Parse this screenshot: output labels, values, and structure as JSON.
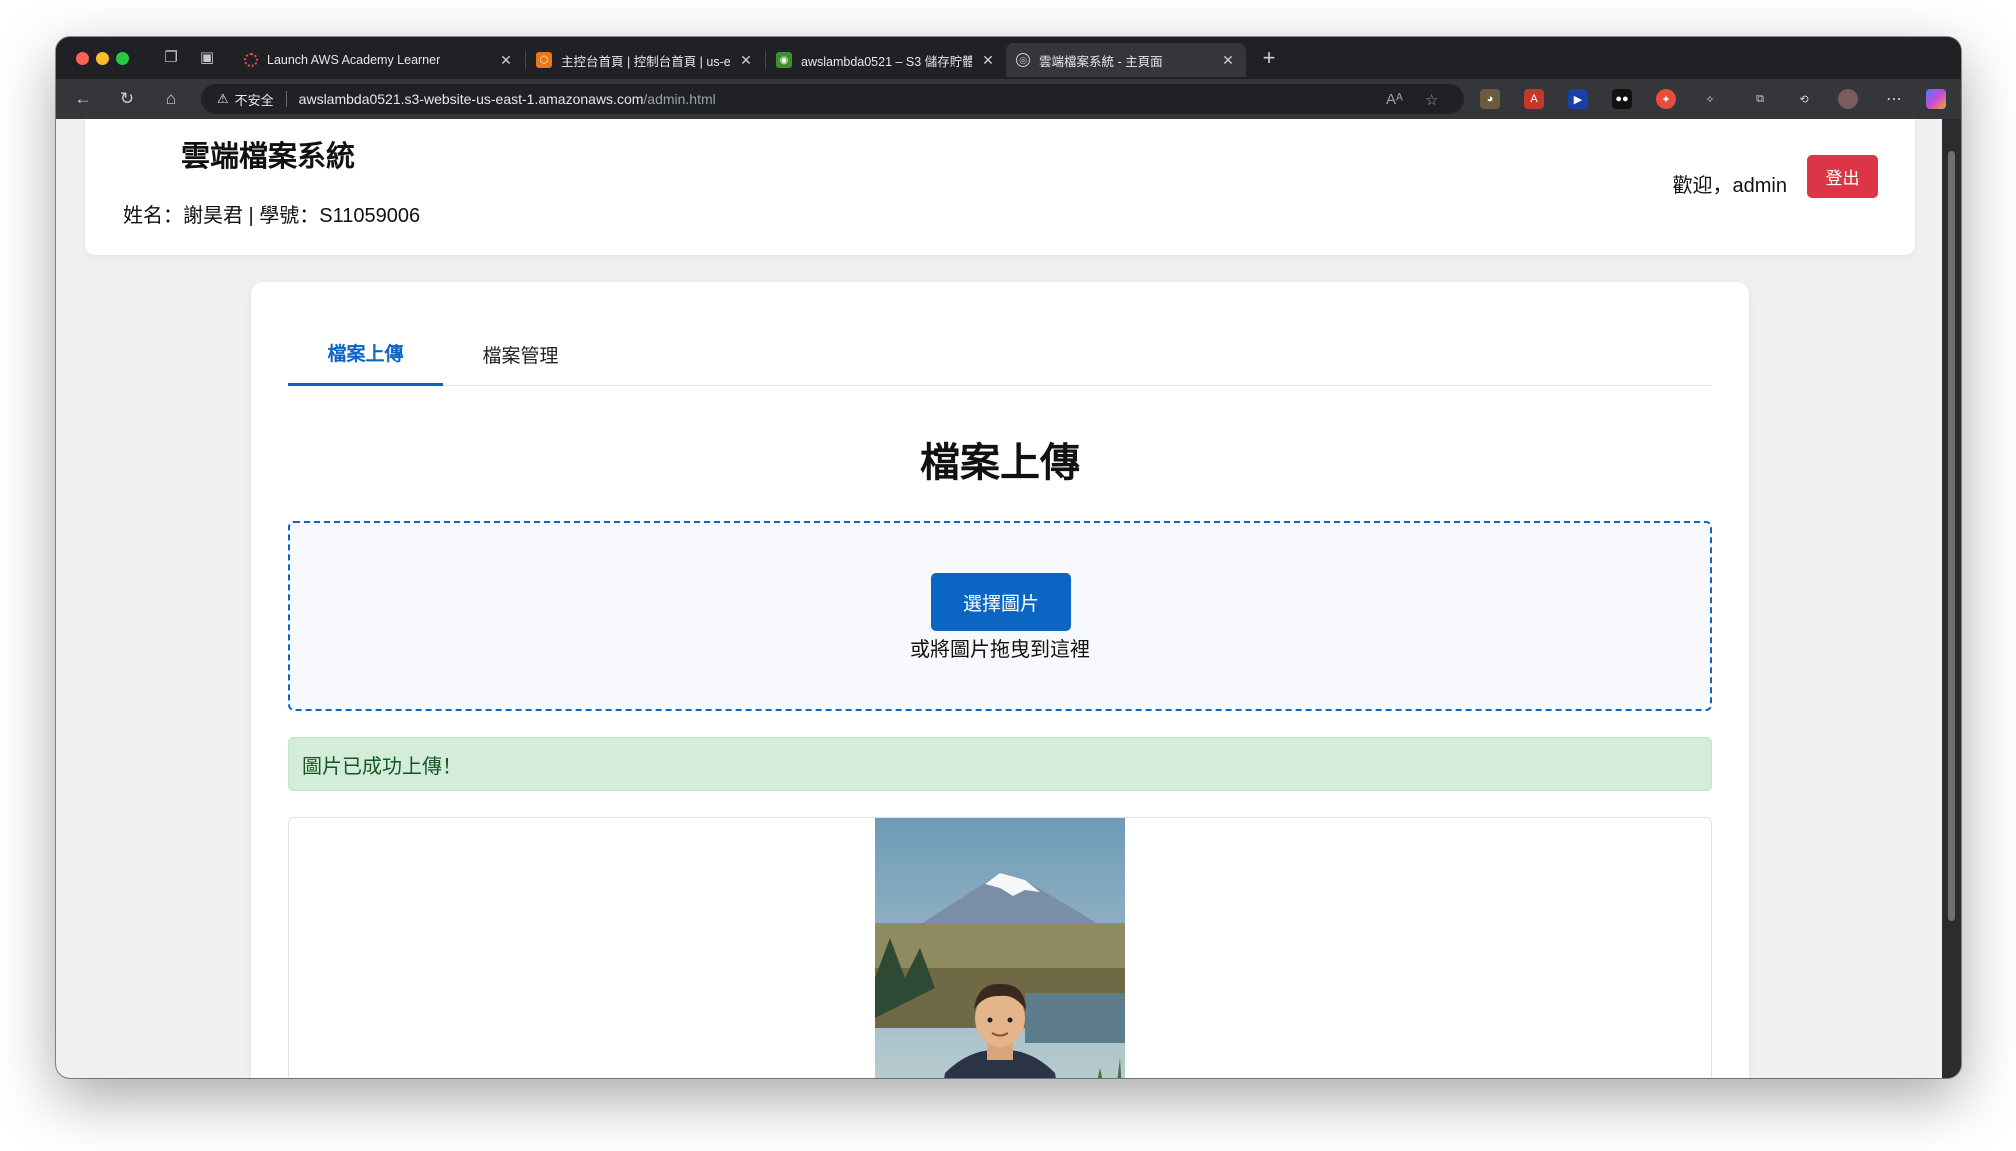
{
  "browser": {
    "tabs": [
      {
        "title": "Launch AWS Academy Learner",
        "icon": "aws-academy-icon",
        "active": false
      },
      {
        "title": "主控台首頁 | 控制台首頁 | us-east",
        "icon": "aws-console-icon",
        "active": false
      },
      {
        "title": "awslambda0521 – S3 儲存貯體 |",
        "icon": "s3-bucket-icon",
        "active": false
      },
      {
        "title": "雲端檔案系統 - 主頁面",
        "icon": "globe-icon",
        "active": true
      }
    ],
    "address": {
      "security_label": "不安全",
      "host": "awslambda0521.s3-website-us-east-1.amazonaws.com",
      "path": "/admin.html"
    }
  },
  "header": {
    "title": "雲端檔案系統",
    "student_info": "姓名：謝昊君 | 學號：S11059006",
    "welcome": "歡迎，admin",
    "logout_label": "登出"
  },
  "main": {
    "tabs": [
      {
        "label": "檔案上傳",
        "active": true
      },
      {
        "label": "檔案管理",
        "active": false
      }
    ],
    "section_title": "檔案上傳",
    "choose_button": "選擇圖片",
    "drop_hint": "或將圖片拖曳到這裡",
    "success_message": "圖片已成功上傳！"
  },
  "colors": {
    "primary": "#0a66c2",
    "danger": "#dc3545",
    "success_bg": "#d4edda",
    "success_text": "#155724"
  }
}
